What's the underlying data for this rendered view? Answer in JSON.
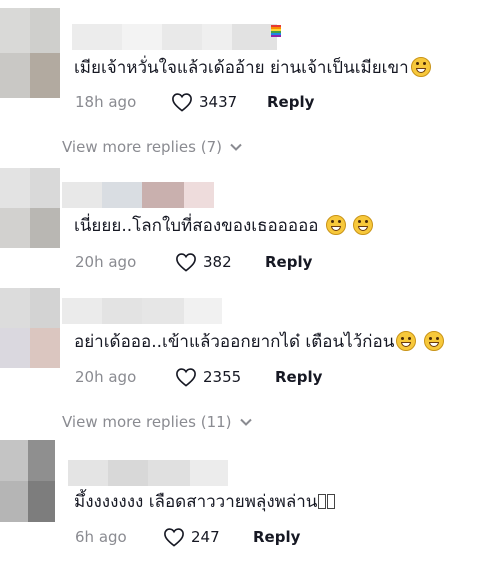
{
  "comments": [
    {
      "text": "เมียเจ้าหวั่นใจแล้วเด้ออ้าย ย่านเจ้าเป็นเมียเขา",
      "time": "18h ago",
      "likes": "3437",
      "reply_label": "Reply",
      "emoji": [
        "tears-of-joy-emoji"
      ]
    },
    {
      "text": "เนี่ยยย..โลกใบที่สองของเธอออออ",
      "time": "20h ago",
      "likes": "382",
      "reply_label": "Reply",
      "emoji": [
        "tears-of-joy-emoji",
        "tears-of-joy-emoji"
      ]
    },
    {
      "text": "อย่าเด้อออ..เข้าแล้วออกยากได๋ เตือนไว้ก่อน",
      "time": "20h ago",
      "likes": "2355",
      "reply_label": "Reply",
      "emoji": [
        "grinning-emoji",
        "grinning-emoji"
      ]
    },
    {
      "text": "มึ้งงงงงงง เลือดสาววายพลุ่งพล่าน",
      "time": "6h ago",
      "likes": "247",
      "reply_label": "Reply",
      "emoji": [
        "missing-glyph-box",
        "missing-glyph-box"
      ]
    }
  ],
  "view_more": [
    {
      "label": "View more replies (7)"
    },
    {
      "label": "View more replies (11)"
    }
  ],
  "icons": {
    "like": "heart-outline-icon",
    "expand": "chevron-down-icon"
  },
  "colors": {
    "text": "#161823",
    "muted": "#8a8b91",
    "background": "#ffffff"
  }
}
